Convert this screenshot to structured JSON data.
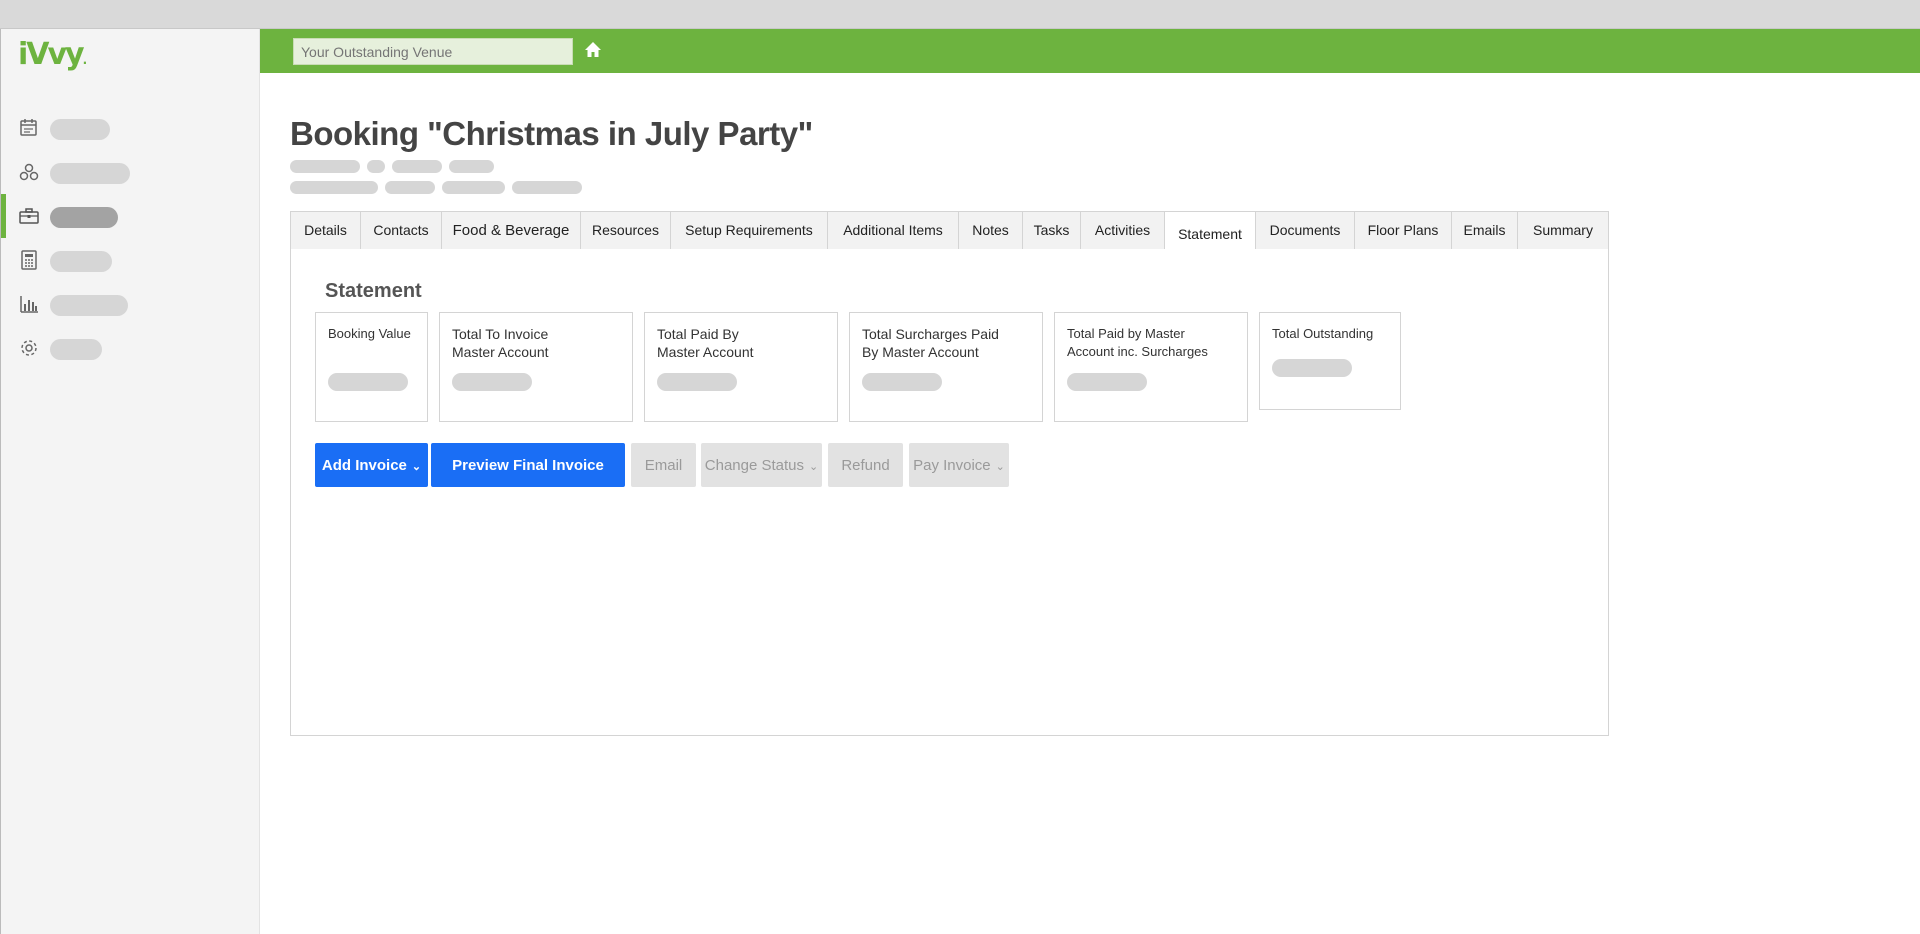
{
  "app": {
    "logo_text": "iVvy",
    "logo_dot": "."
  },
  "colors": {
    "brand_green": "#6db33f",
    "primary_blue": "#1a6ef5",
    "skeleton": "#d6d6d6"
  },
  "sidebar": {
    "items": [
      {
        "icon": "calendar-icon",
        "active": false
      },
      {
        "icon": "contacts-icon",
        "active": false
      },
      {
        "icon": "briefcase-icon",
        "active": true
      },
      {
        "icon": "calculator-icon",
        "active": false
      },
      {
        "icon": "bar-chart-icon",
        "active": false
      },
      {
        "icon": "gear-icon",
        "active": false
      }
    ]
  },
  "header": {
    "venue_placeholder": "Your Outstanding Venue",
    "home_icon": "home-icon"
  },
  "booking": {
    "title": "Booking \"Christmas in July Party\""
  },
  "tabs": [
    {
      "label": "Details"
    },
    {
      "label": "Contacts"
    },
    {
      "label": "Food & Beverage"
    },
    {
      "label": "Resources"
    },
    {
      "label": "Setup Requirements"
    },
    {
      "label": "Additional Items"
    },
    {
      "label": "Notes"
    },
    {
      "label": "Tasks"
    },
    {
      "label": "Activities"
    },
    {
      "label": "Statement",
      "active": true
    },
    {
      "label": "Documents"
    },
    {
      "label": "Floor Plans"
    },
    {
      "label": "Emails"
    },
    {
      "label": "Summary"
    }
  ],
  "statement": {
    "heading": "Statement",
    "cards": [
      {
        "label_1": "Booking Value",
        "label_2": ""
      },
      {
        "label_1": "Total To Invoice",
        "label_2": "Master Account"
      },
      {
        "label_1": "Total Paid By",
        "label_2": "Master Account"
      },
      {
        "label_1": "Total Surcharges Paid",
        "label_2": "By Master Account"
      },
      {
        "label_1": "Total Paid by Master",
        "label_2": "Account inc. Surcharges"
      },
      {
        "label_1": "Total Outstanding",
        "label_2": ""
      }
    ]
  },
  "actions": {
    "add_invoice": "Add Invoice",
    "preview_final_invoice": "Preview Final Invoice",
    "email": "Email",
    "change_status": "Change Status",
    "refund": "Refund",
    "pay_invoice": "Pay Invoice",
    "caret": "⌄"
  }
}
